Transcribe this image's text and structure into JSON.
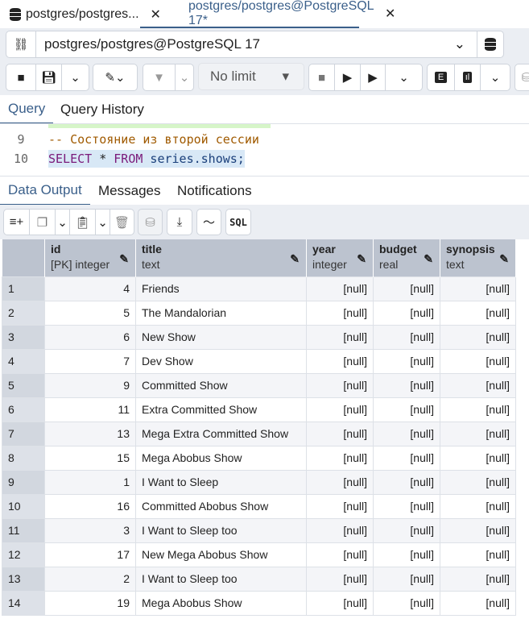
{
  "tabs": [
    {
      "label": "postgres/postgres...",
      "active": false
    },
    {
      "label": "postgres/postgres@PostgreSQL 17*",
      "active": true
    }
  ],
  "connection": {
    "value": "postgres/postgres@PostgreSQL 17"
  },
  "toolbar": {
    "limit": "No limit"
  },
  "query_tabs": [
    "Query",
    "Query History"
  ],
  "editor": {
    "lines": [
      {
        "n": "9",
        "text": "-- Состояние из второй сессии"
      },
      {
        "n": "10",
        "kw1": "SELECT",
        "mid": " * ",
        "kw2": "FROM",
        "rest": " series.shows;"
      }
    ]
  },
  "result_tabs": [
    "Data Output",
    "Messages",
    "Notifications"
  ],
  "result_toolbar": {
    "sql": "SQL"
  },
  "columns": [
    {
      "name": "id",
      "type": "[PK] integer"
    },
    {
      "name": "title",
      "type": "text"
    },
    {
      "name": "year",
      "type": "integer"
    },
    {
      "name": "budget",
      "type": "real"
    },
    {
      "name": "synopsis",
      "type": "text"
    }
  ],
  "rows": [
    [
      "1",
      "4",
      "Friends",
      "[null]",
      "[null]",
      "[null]"
    ],
    [
      "2",
      "5",
      "The Mandalorian",
      "[null]",
      "[null]",
      "[null]"
    ],
    [
      "3",
      "6",
      "New Show",
      "[null]",
      "[null]",
      "[null]"
    ],
    [
      "4",
      "7",
      "Dev Show",
      "[null]",
      "[null]",
      "[null]"
    ],
    [
      "5",
      "9",
      "Committed Show",
      "[null]",
      "[null]",
      "[null]"
    ],
    [
      "6",
      "11",
      "Extra Committed Show",
      "[null]",
      "[null]",
      "[null]"
    ],
    [
      "7",
      "13",
      "Mega Extra Committed Show",
      "[null]",
      "[null]",
      "[null]"
    ],
    [
      "8",
      "15",
      "Mega Abobus Show",
      "[null]",
      "[null]",
      "[null]"
    ],
    [
      "9",
      "1",
      "I Want to Sleep",
      "[null]",
      "[null]",
      "[null]"
    ],
    [
      "10",
      "16",
      "Committed Abobus Show",
      "[null]",
      "[null]",
      "[null]"
    ],
    [
      "11",
      "3",
      "I Want to Sleep too",
      "[null]",
      "[null]",
      "[null]"
    ],
    [
      "12",
      "17",
      "New Mega Abobus Show",
      "[null]",
      "[null]",
      "[null]"
    ],
    [
      "13",
      "2",
      "I Want to Sleep too",
      "[null]",
      "[null]",
      "[null]"
    ],
    [
      "14",
      "19",
      "Mega Abobus Show",
      "[null]",
      "[null]",
      "[null]"
    ]
  ]
}
